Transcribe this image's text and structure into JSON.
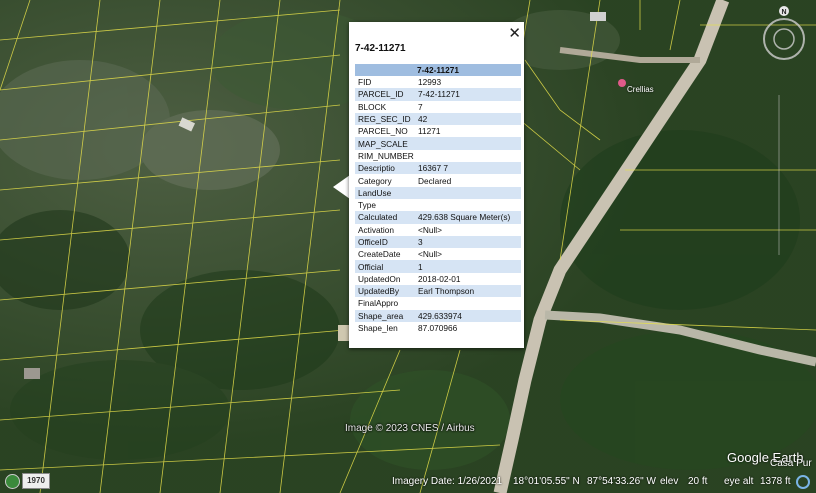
{
  "popup": {
    "title": "7-42-11271",
    "table_header": "7-42-11271",
    "close_glyph": "✕",
    "rows": [
      {
        "key": "FID",
        "value": "12993"
      },
      {
        "key": "PARCEL_ID",
        "value": "7-42-11271"
      },
      {
        "key": "BLOCK",
        "value": "7"
      },
      {
        "key": "REG_SEC_ID",
        "value": "42"
      },
      {
        "key": "PARCEL_NO",
        "value": "11271"
      },
      {
        "key": "MAP_SCALE",
        "value": ""
      },
      {
        "key": "RIM_NUMBER",
        "value": ""
      },
      {
        "key": "Descriptio",
        "value": "16367 7"
      },
      {
        "key": "Category",
        "value": "Declared"
      },
      {
        "key": "LandUse",
        "value": ""
      },
      {
        "key": "Type",
        "value": ""
      },
      {
        "key": "Calculated",
        "value": "429.638 Square Meter(s)"
      },
      {
        "key": "Activation",
        "value": "<Null>"
      },
      {
        "key": "OfficeID",
        "value": "3"
      },
      {
        "key": "CreateDate",
        "value": "<Null>"
      },
      {
        "key": "Official",
        "value": "1"
      },
      {
        "key": "UpdatedOn",
        "value": "2018-02-01"
      },
      {
        "key": "UpdatedBy",
        "value": "Earl Thompson"
      },
      {
        "key": "FinalAppro",
        "value": ""
      },
      {
        "key": "Shape_area",
        "value": "429.633974"
      },
      {
        "key": "Shape_len",
        "value": "87.070966"
      }
    ]
  },
  "map": {
    "copyright": "Image © 2023 CNES / Airbus",
    "place_label": "Crellias",
    "place_label_2": "Casa Pur",
    "logo": "Google Earth",
    "compass_north": "N"
  },
  "status_bar": {
    "year": "1970",
    "imagery_date": "Imagery Date: 1/26/2021",
    "latitude": "18°01'05.55\" N",
    "longitude": "87°54'33.26\" W",
    "elev_label": "elev",
    "elev_value": "20 ft",
    "eye_alt_label": "eye alt",
    "eye_alt_value": "1378 ft"
  },
  "colors": {
    "parcel_lines": "#e6e04a",
    "road": "#c9c2b2",
    "table_header": "#9fbde0",
    "table_alt_row": "#d6e4f4",
    "vegetation": "#2b4a26"
  }
}
